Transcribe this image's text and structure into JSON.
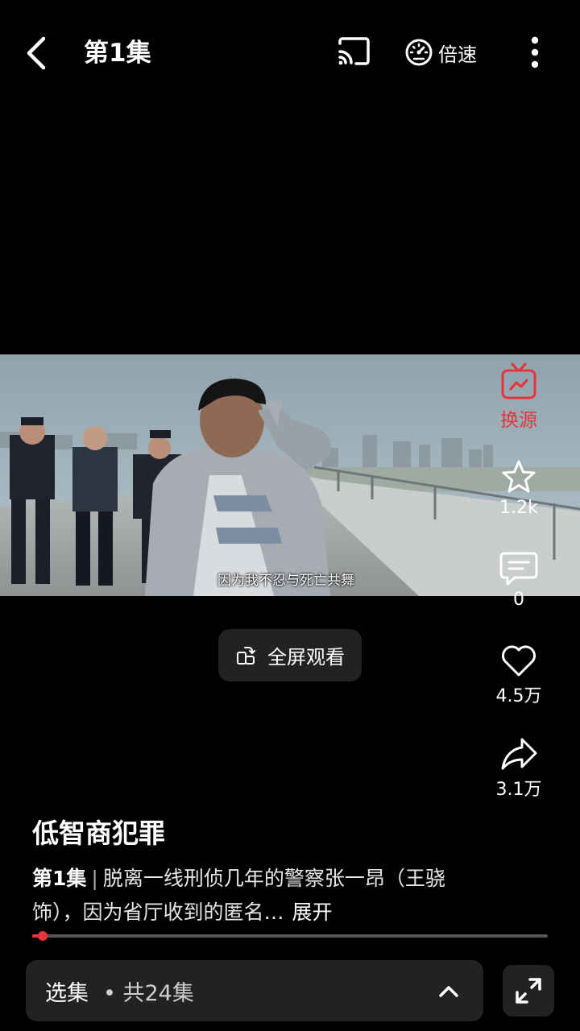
{
  "top_bar": {
    "episode_title": "第1集",
    "speed_label": "倍速"
  },
  "video": {
    "subtitle": "因为我不忍与死亡共舞"
  },
  "fullscreen_watch": {
    "label": "全屏观看"
  },
  "rail": {
    "switch_source_label": "换源",
    "favorite_count": "1.2k",
    "comment_count": "0",
    "like_count": "4.5万",
    "share_count": "3.1万",
    "accent_color": "#e8333d"
  },
  "info": {
    "title": "低智商犯罪",
    "episode_tag": "第1集",
    "separator": "|",
    "description": "脱离一线刑侦几年的警察张一昂（王骁 饰），因为省厅收到的匿名…",
    "expand_label": "展开"
  },
  "progress": {
    "fraction": 0.02
  },
  "bottom": {
    "selector_label": "选集",
    "selector_count": "• 共24集"
  }
}
